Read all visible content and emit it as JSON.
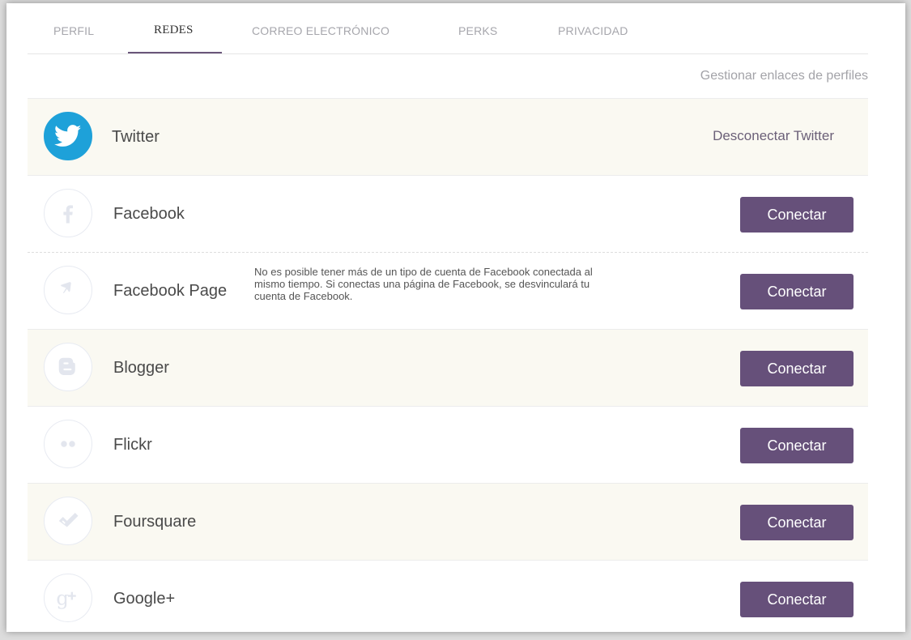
{
  "tabs": [
    {
      "label": "PERFIL"
    },
    {
      "label": "REDES",
      "active": true
    },
    {
      "label": "CORREO ELECTRÓNICO"
    },
    {
      "label": "PERKS"
    },
    {
      "label": "PRIVACIDAD"
    }
  ],
  "manage_link": "Gestionar enlaces de perfiles",
  "networks": [
    {
      "name": "Twitter",
      "icon": "twitter-icon",
      "connected": true,
      "action": "Desconectar Twitter"
    },
    {
      "name": "Facebook",
      "icon": "facebook-icon",
      "connected": false,
      "action": "Conectar"
    },
    {
      "name": "Facebook Page",
      "icon": "flag-icon",
      "connected": false,
      "action": "Conectar",
      "note": "No es posible tener más de un tipo de cuenta de Facebook conectada al mismo tiempo. Si conectas una página de Facebook, se desvinculará tu cuenta de Facebook."
    },
    {
      "name": "Blogger",
      "icon": "blogger-icon",
      "connected": false,
      "action": "Conectar"
    },
    {
      "name": "Flickr",
      "icon": "flickr-icon",
      "connected": false,
      "action": "Conectar"
    },
    {
      "name": "Foursquare",
      "icon": "foursquare-icon",
      "connected": false,
      "action": "Conectar"
    },
    {
      "name": "Google+",
      "icon": "google-plus-icon",
      "connected": false,
      "action": "Conectar"
    }
  ],
  "colors": {
    "accent": "#66507a",
    "twitter": "#1ea1d9",
    "row_alt_bg": "#faf9f2",
    "icon_placeholder": "#e3e6ee"
  }
}
